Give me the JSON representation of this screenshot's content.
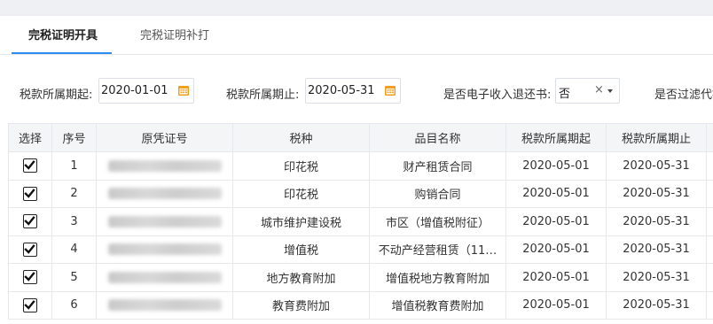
{
  "tabs": [
    {
      "label": "完税证明开具",
      "active": true
    },
    {
      "label": "完税证明补打",
      "active": false
    }
  ],
  "filters": {
    "period_start_label": "税款所属期起:",
    "period_start_value": "2020-01-01",
    "period_end_label": "税款所属期止:",
    "period_end_value": "2020-05-31",
    "electronic_refund_label": "是否电子收入退还书:",
    "electronic_refund_value": "否",
    "clear_symbol": "×",
    "filter_cut_label": "是否过滤代扣"
  },
  "table": {
    "headers": [
      "选择",
      "序号",
      "原凭证号",
      "税种",
      "品目名称",
      "税款所属期起",
      "税款所属期止"
    ],
    "rows": [
      {
        "seq": "1",
        "tax_type": "印花税",
        "item": "财产租赁合同",
        "start": "2020-05-01",
        "end": "2020-05-31"
      },
      {
        "seq": "2",
        "tax_type": "印花税",
        "item": "购销合同",
        "start": "2020-05-01",
        "end": "2020-05-31"
      },
      {
        "seq": "3",
        "tax_type": "城市维护建设税",
        "item": "市区（增值税附征）",
        "start": "2020-05-01",
        "end": "2020-05-31"
      },
      {
        "seq": "4",
        "tax_type": "增值税",
        "item": "不动产经营租赁（11…",
        "start": "2020-05-01",
        "end": "2020-05-31"
      },
      {
        "seq": "5",
        "tax_type": "地方教育附加",
        "item": "增值税地方教育附加",
        "start": "2020-05-01",
        "end": "2020-05-31"
      },
      {
        "seq": "6",
        "tax_type": "教育费附加",
        "item": "增值税教育费附加",
        "start": "2020-05-01",
        "end": "2020-05-31"
      }
    ]
  },
  "colors": {
    "accent": "#2d8cf0",
    "calendar": "#f0a020"
  },
  "icons": {
    "date": "calendar-icon",
    "check": "checkmark-icon",
    "dropdown": "chevron-down-icon",
    "clear": "close-icon"
  }
}
